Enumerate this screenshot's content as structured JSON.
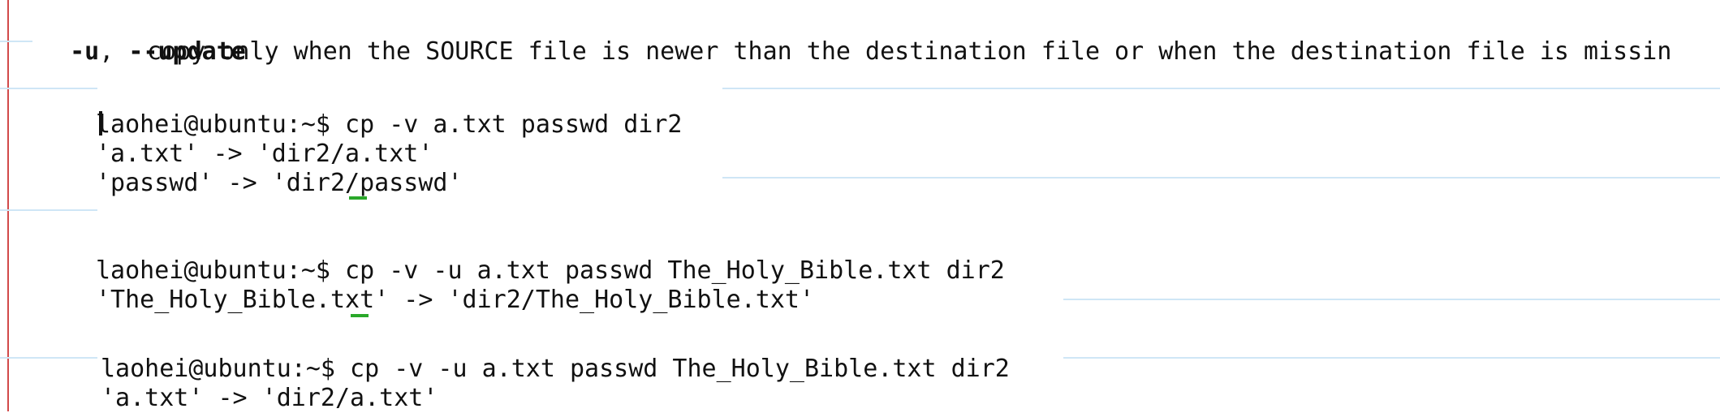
{
  "option": {
    "flags_short": "-u",
    "flags_sep": ", ",
    "flags_long": "--update",
    "description": "copy only when the SOURCE file is newer than the destination file or when the destination file is missin"
  },
  "blocks": [
    {
      "lines": [
        "laohei@ubuntu:~$ cp -v a.txt passwd dir2",
        "'a.txt' -> 'dir2/a.txt'",
        "'passwd' -> 'dir2/passwd'"
      ]
    },
    {
      "lines": [
        "laohei@ubuntu:~$ cp -v -u a.txt passwd The_Holy_Bible.txt dir2",
        "'The_Holy_Bible.txt' -> 'dir2/The_Holy_Bible.txt'"
      ]
    },
    {
      "lines": [
        "laohei@ubuntu:~$ cp -v -u a.txt passwd The_Holy_Bible.txt dir2",
        "'a.txt' -> 'dir2/a.txt'"
      ]
    }
  ],
  "colors": {
    "margin_rule": "#d24a4a",
    "notebook_rule": "#cfe6f6",
    "text": "#111111",
    "cursor_mark": "#2aa82a"
  }
}
